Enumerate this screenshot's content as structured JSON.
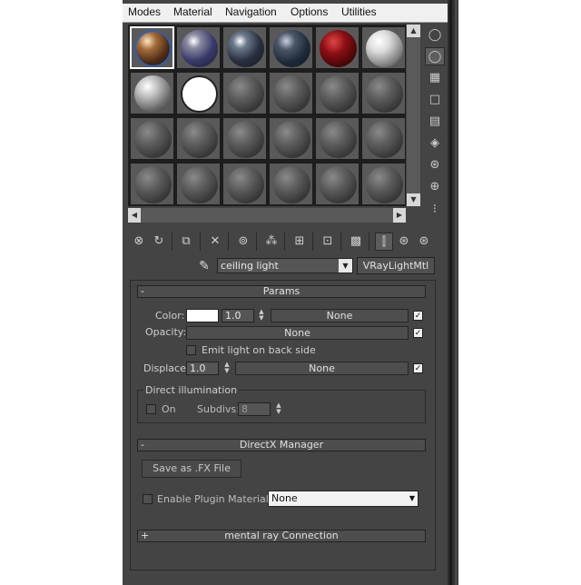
{
  "menu": {
    "items": [
      "Modes",
      "Material",
      "Navigation",
      "Options",
      "Utilities"
    ]
  },
  "slots": {
    "selected_index": 0,
    "colors": {
      "background": "#595959",
      "selected_outline": "#ffffff",
      "border": "#1c1c1c"
    }
  },
  "scroll": {
    "up": "▲",
    "down": "▼",
    "left": "◀",
    "right": "▶"
  },
  "material": {
    "picker_icon": "eyedropper-icon",
    "name": "ceiling light",
    "type": "VRayLightMtl"
  },
  "params": {
    "title": "Params",
    "collapse": "-",
    "color_label": "Color:",
    "color_value": "#ffffff",
    "color_multiplier": "1.0",
    "color_map": "None",
    "opacity_label": "Opacity:",
    "opacity_map": "None",
    "emit_back_label": "Emit light on back side",
    "displace_label": "Displace:",
    "displace_value": "1.0",
    "displace_map": "None",
    "direct_group_label": "Direct illumination",
    "on_label": "On",
    "subdivs_label": "Subdivs:",
    "subdivs_value": "8"
  },
  "directx": {
    "title": "DirectX Manager",
    "collapse": "-",
    "save_fx_label": "Save as .FX File",
    "enable_plugin_label": "Enable Plugin Material",
    "plugin_select_value": "None"
  },
  "mental_ray": {
    "title": "mental ray Connection",
    "expand": "+"
  }
}
